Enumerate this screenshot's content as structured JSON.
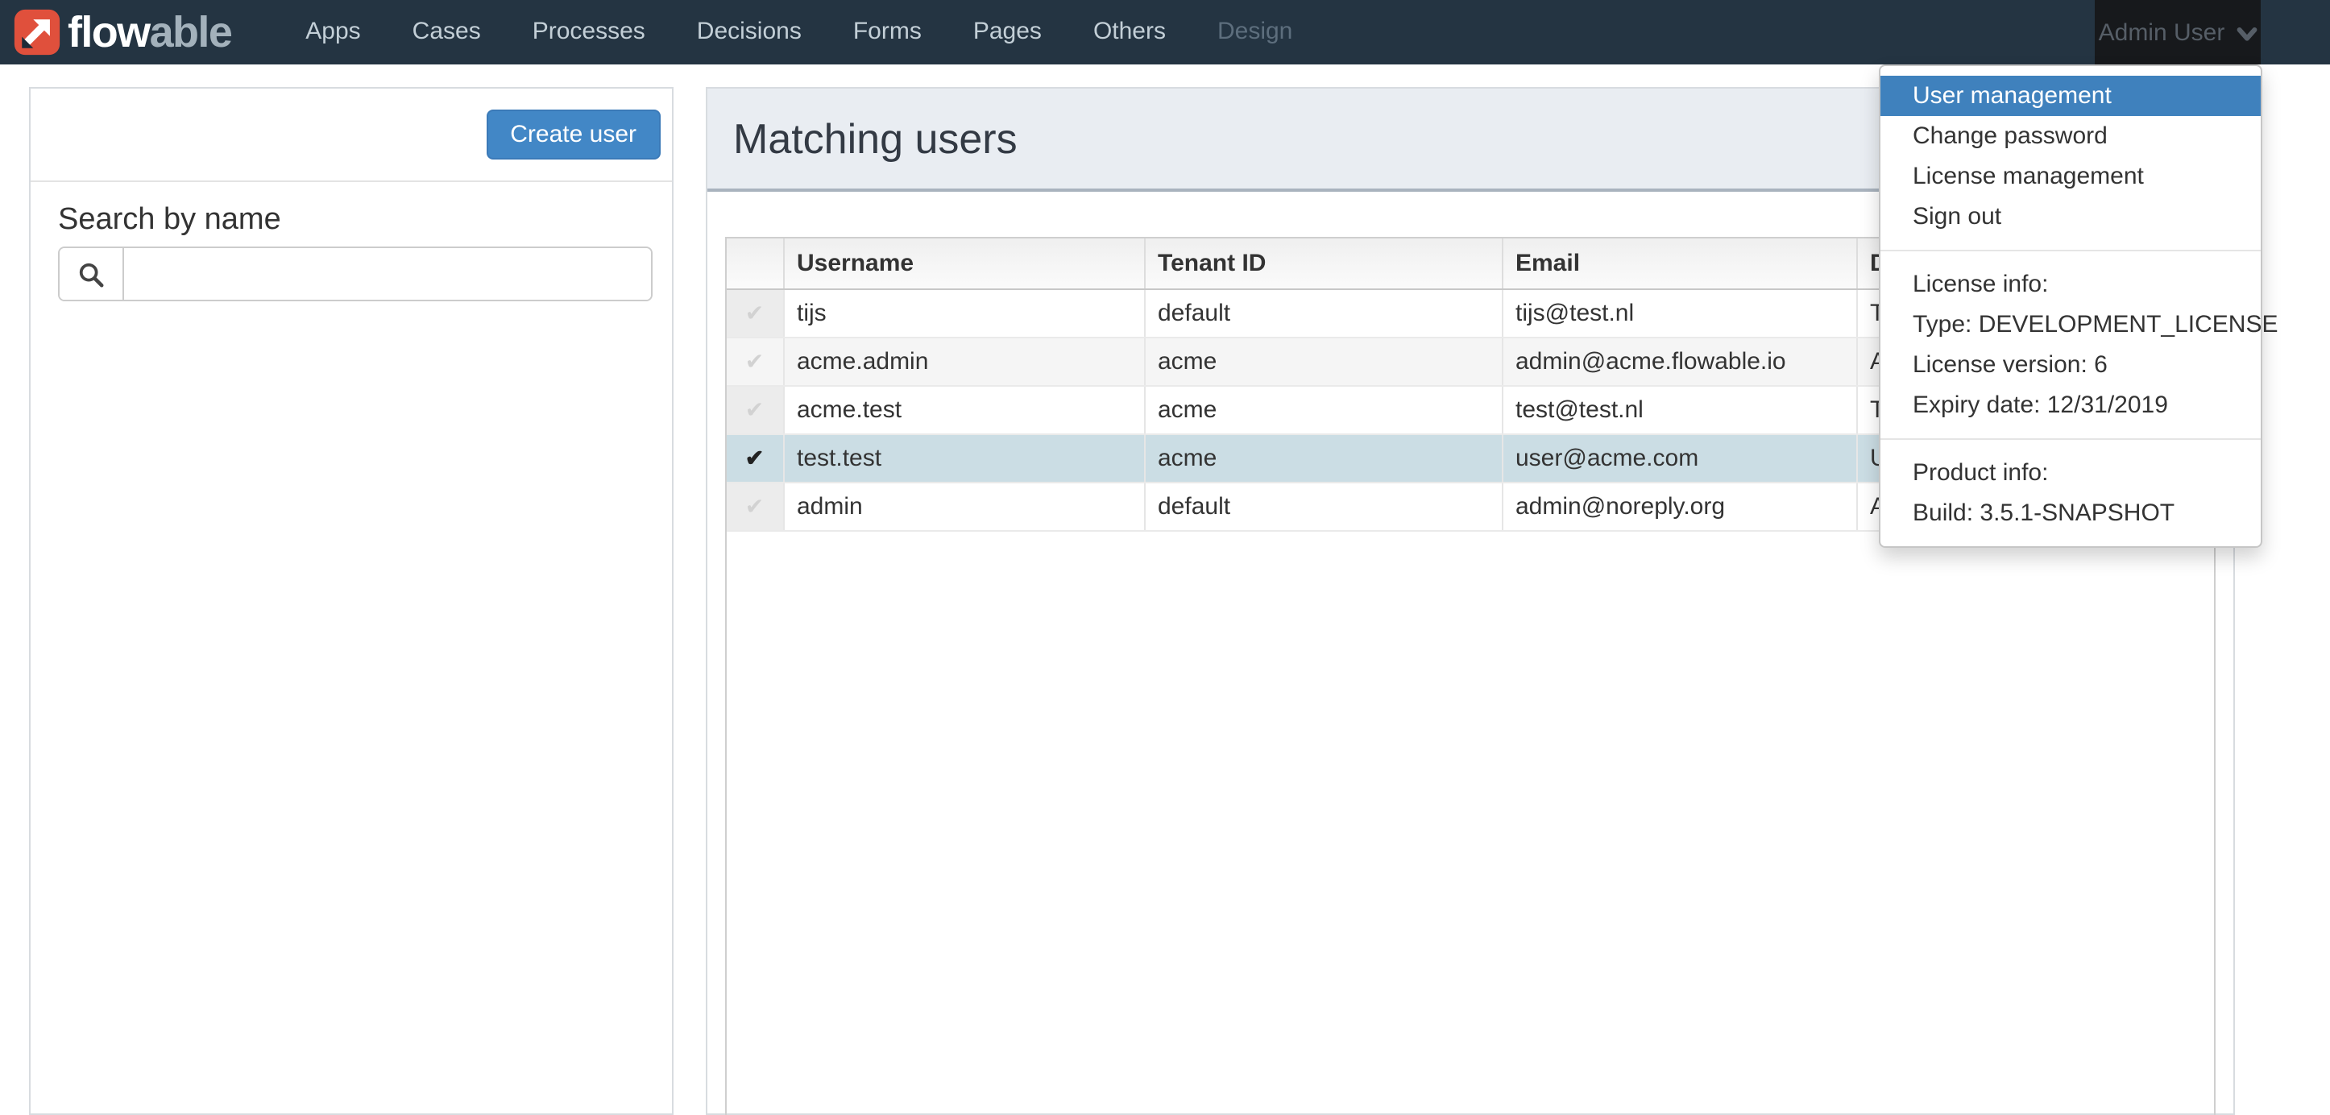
{
  "navbar": {
    "brand": {
      "text_primary": "flow",
      "text_secondary": "able"
    },
    "items": [
      {
        "label": "Apps"
      },
      {
        "label": "Cases"
      },
      {
        "label": "Processes"
      },
      {
        "label": "Decisions"
      },
      {
        "label": "Forms"
      },
      {
        "label": "Pages"
      },
      {
        "label": "Others"
      },
      {
        "label": "Design",
        "muted": true
      }
    ],
    "user_menu": {
      "label": "Admin User"
    }
  },
  "user_dropdown": {
    "items": [
      {
        "label": "User management",
        "active": true
      },
      {
        "label": "Change password"
      },
      {
        "label": "License management"
      },
      {
        "label": "Sign out"
      }
    ],
    "license_info": {
      "heading": "License info:",
      "type": "Type: DEVELOPMENT_LICENSE",
      "version": "License version: 6",
      "expiry": "Expiry date: 12/31/2019"
    },
    "product_info": {
      "heading": "Product info:",
      "build": "Build: 3.5.1-SNAPSHOT"
    }
  },
  "sidebar": {
    "create_user_label": "Create user",
    "search_heading": "Search by name",
    "search_value": "",
    "search_placeholder": ""
  },
  "main": {
    "title": "Matching users",
    "table": {
      "headers": {
        "check": "",
        "username": "Username",
        "tenant": "Tenant ID",
        "email": "Email",
        "partial": "D"
      },
      "rows": [
        {
          "username": "tijs",
          "tenant": "default",
          "email": "tijs@test.nl",
          "partial": "T",
          "selected": false
        },
        {
          "username": "acme.admin",
          "tenant": "acme",
          "email": "admin@acme.flowable.io",
          "partial": "A",
          "selected": false
        },
        {
          "username": "acme.test",
          "tenant": "acme",
          "email": "test@test.nl",
          "partial": "T",
          "selected": false
        },
        {
          "username": "test.test",
          "tenant": "acme",
          "email": "user@acme.com",
          "partial": "U",
          "selected": true
        },
        {
          "username": "admin",
          "tenant": "default",
          "email": "admin@noreply.org",
          "partial": "A",
          "selected": false
        }
      ]
    }
  },
  "icons": {
    "row_check": "✔"
  },
  "colors": {
    "navbar_bg": "#243442",
    "dropdown_active_bg": "#3f81bd",
    "create_button_bg": "#4287c6",
    "selected_row_bg": "#cbdde4",
    "title_bar_bg": "#e9edf2",
    "logo_red": "#e0503c"
  }
}
